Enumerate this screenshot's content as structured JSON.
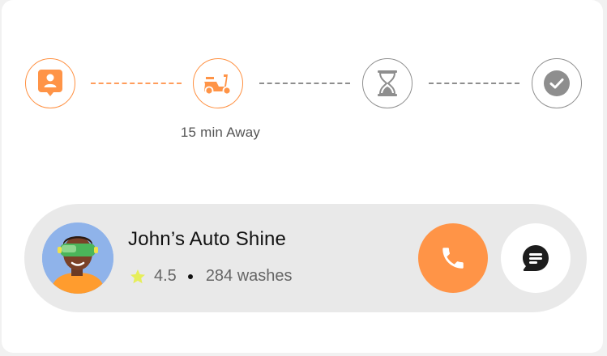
{
  "progress": {
    "steps": [
      {
        "icon": "profile-pin-icon",
        "state": "completed"
      },
      {
        "icon": "scooter-icon",
        "state": "current"
      },
      {
        "icon": "hourglass-icon",
        "state": "pending"
      },
      {
        "icon": "check-icon",
        "state": "pending"
      }
    ],
    "eta_label": "15 min Away"
  },
  "provider": {
    "name": "John’s Auto Shine",
    "rating": "4.5",
    "washes": "284 washes",
    "avatar": "avatar-icon",
    "call_icon": "phone-icon",
    "chat_icon": "chat-icon"
  },
  "colors": {
    "accent": "#ff9447",
    "inactive": "#8e8e8e",
    "panel": "#e9e9e9",
    "star": "#e6ee5a"
  }
}
